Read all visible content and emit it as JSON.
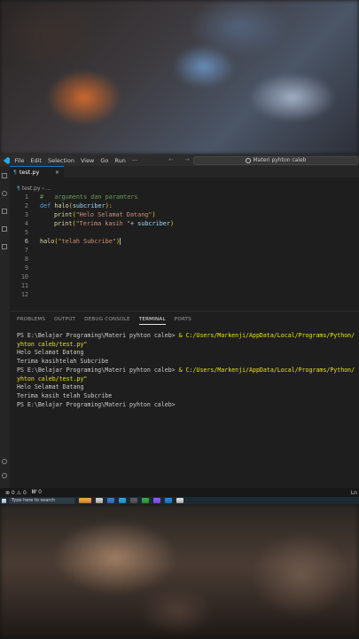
{
  "menubar": {
    "items": [
      "File",
      "Edit",
      "Selection",
      "View",
      "Go",
      "Run",
      "···"
    ],
    "nav_arrows": "← →",
    "search_text": "Materi pyhton caleb"
  },
  "tab": {
    "icon": "¶",
    "name": "test.py",
    "close": "×"
  },
  "breadcrumb": {
    "icon": "¶",
    "file": "test.py",
    "sep": "›",
    "rest": "..."
  },
  "editor": {
    "line_numbers": [
      "1",
      "2",
      "3",
      "4",
      "5",
      "6",
      "7",
      "8",
      "9",
      "10",
      "11",
      "12"
    ],
    "active_line": "6",
    "lines": {
      "l1_comment": "#   arguments dan paramters",
      "l2_def": "def",
      "l2_name": "halo",
      "l2_paren_open": "(",
      "l2_param": "subcriber",
      "l2_tail": "):",
      "l3_fn": "print",
      "l3_open": "(",
      "l3_str": "\"Helo Selamat Datang\"",
      "l3_close": ")",
      "l4_fn": "print",
      "l4_open": "(",
      "l4_str": "\"Terima kasih \"",
      "l4_op": "+ ",
      "l4_var": "subcriber",
      "l4_close": ")",
      "l6_fn": "halo",
      "l6_open": "(",
      "l6_str": "\"telah Subcribe\"",
      "l6_close": ")"
    }
  },
  "panel": {
    "tabs": [
      "PROBLEMS",
      "OUTPUT",
      "DEBUG CONSOLE",
      "TERMINAL",
      "PORTS"
    ],
    "active_tab": "TERMINAL",
    "terminal": {
      "prompt1": "PS E:\\Belajar Programing\\Materi pyhton caleb> ",
      "cmd1": "& C:/Users/Markenji/AppData/Local/Programs/Python/",
      "cmd1_cont": "yhton caleb/test.py\"",
      "out1a": "Helo Selamat Datang",
      "out1b": "Terima kasihtelah Subcribe",
      "prompt2": "PS E:\\Belajar Programing\\Materi pyhton caleb> ",
      "cmd2": "& C:/Users/Markenji/AppData/Local/Programs/Python/",
      "cmd2_cont": "yhton caleb/test.py\"",
      "out2a": "Helo Selamat Datang",
      "out2b": "Terima kasih telah Subcribe",
      "prompt3": "PS E:\\Belajar Programing\\Materi pyhton caleb>"
    }
  },
  "status": {
    "errors": "⊗ 0 ⚠ 0",
    "ports": "𝑾 0",
    "right": "Ln"
  },
  "taskbar": {
    "search": "Type here to search"
  },
  "colors": {
    "accent": "#0078d4",
    "editor_bg": "#1e1e1e",
    "keyword": "#569cd6",
    "string": "#ce9178",
    "function": "#dcdcaa",
    "comment": "#6a9955",
    "terminal_path": "#e5e510"
  }
}
